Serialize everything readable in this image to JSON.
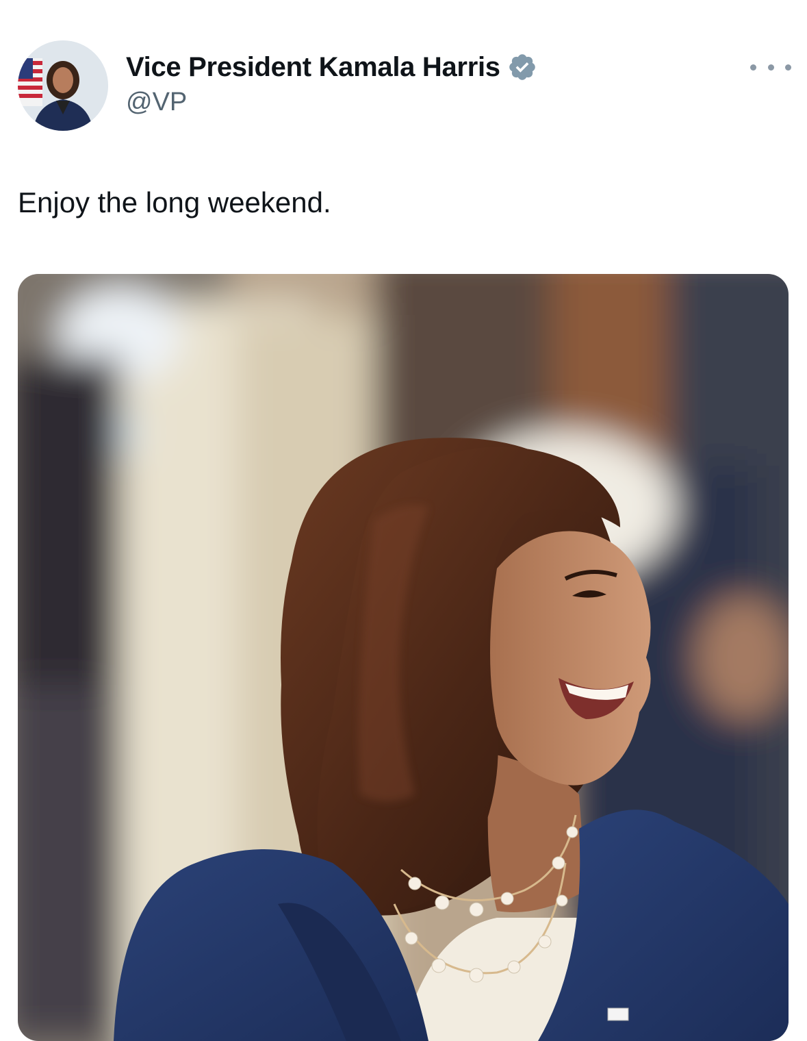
{
  "author": {
    "display_name": "Vice President Kamala Harris",
    "handle": "@VP",
    "verified": true,
    "avatar_icon": "profile-photo",
    "verified_icon": "verified-badge-icon",
    "verified_color": "#829aab"
  },
  "tweet": {
    "text": "Enjoy the long weekend."
  },
  "menu": {
    "icon": "more-options-icon"
  },
  "media": {
    "icon": "photo"
  }
}
